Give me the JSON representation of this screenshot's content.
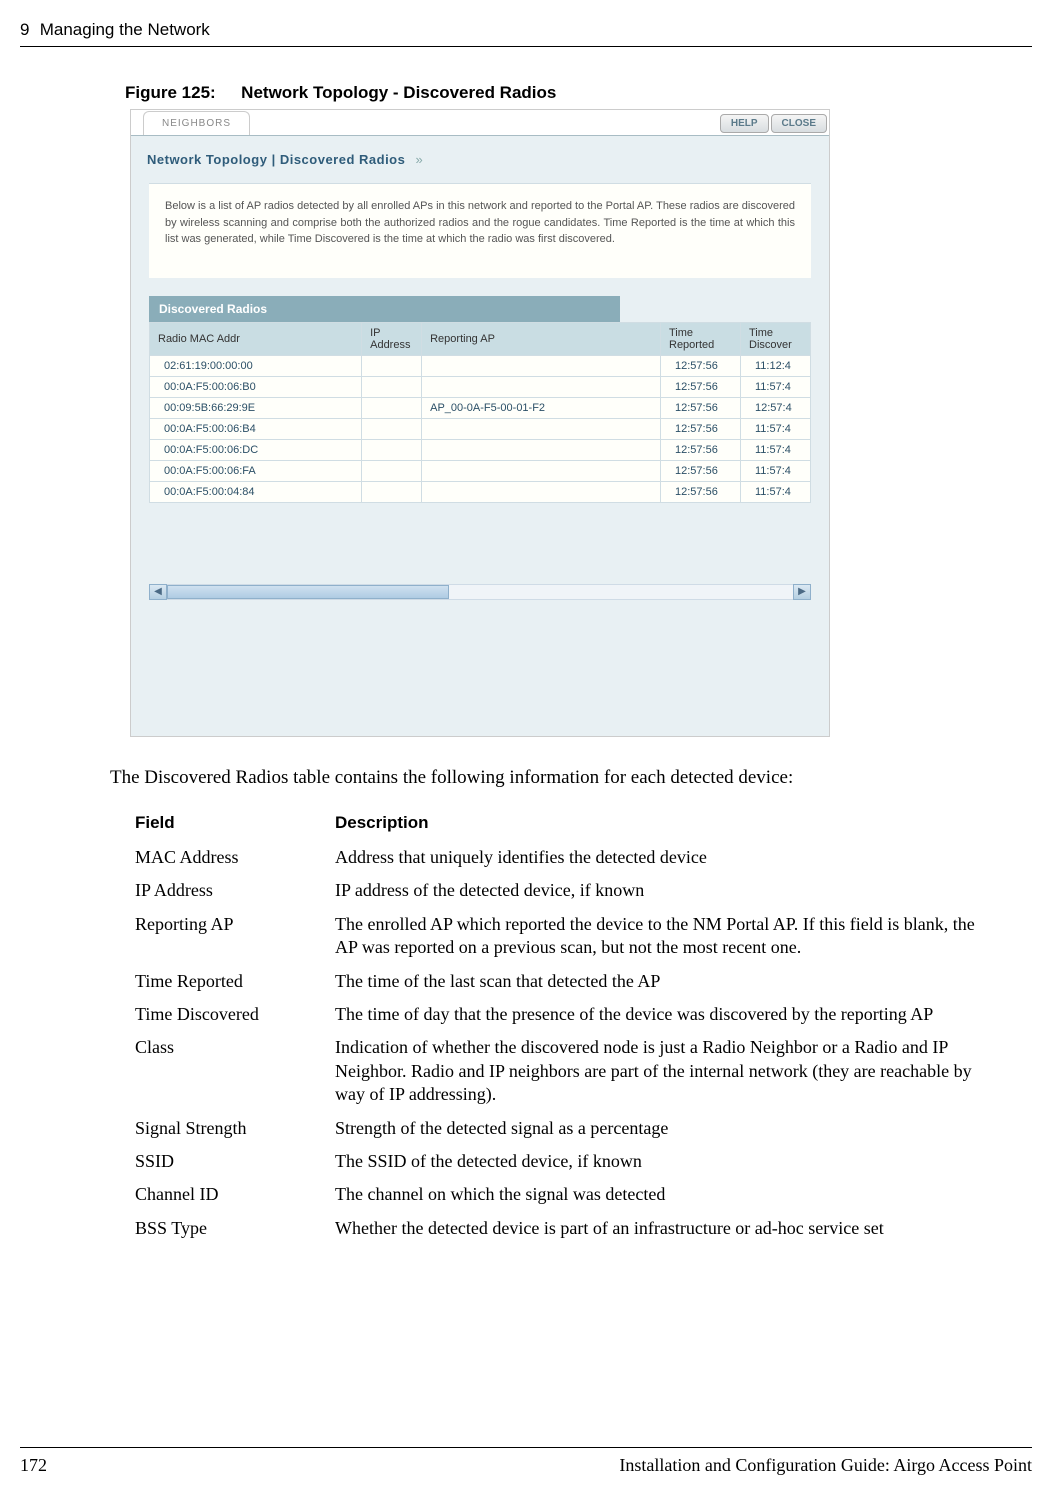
{
  "page": {
    "chapter_num": "9",
    "chapter_title": "Managing the Network",
    "page_number": "172",
    "guide_title": "Installation and Configuration Guide: Airgo Access Point"
  },
  "figure": {
    "label": "Figure 125:",
    "title": "Network Topology - Discovered Radios"
  },
  "screenshot": {
    "tab": "NEIGHBORS",
    "help": "HELP",
    "close": "CLOSE",
    "breadcrumb_main": "Network Topology",
    "breadcrumb_sub": "Discovered Radios",
    "breadcrumb_arrows": "»",
    "intro": "Below is a list of AP radios detected by all enrolled APs in this network and reported to the Portal AP. These radios are discovered by wireless scanning and comprise both the authorized radios and the rogue candidates. Time Reported is the time at which this list was generated, while Time Discovered is the time at which the radio was first discovered.",
    "section_title": "Discovered Radios",
    "columns": {
      "mac": "Radio MAC Addr",
      "ip": "IP Address",
      "reporting": "Reporting AP",
      "time_reported": "Time Reported",
      "time_discovered": "Time Discover"
    },
    "rows": [
      {
        "mac": "02:61:19:00:00:00",
        "ip": "",
        "reporting": "",
        "reported": "12:57:56",
        "discovered": "11:12:4"
      },
      {
        "mac": "00:0A:F5:00:06:B0",
        "ip": "",
        "reporting": "",
        "reported": "12:57:56",
        "discovered": "11:57:4"
      },
      {
        "mac": "00:09:5B:66:29:9E",
        "ip": "",
        "reporting": "AP_00-0A-F5-00-01-F2",
        "reported": "12:57:56",
        "discovered": "12:57:4"
      },
      {
        "mac": "00:0A:F5:00:06:B4",
        "ip": "",
        "reporting": "",
        "reported": "12:57:56",
        "discovered": "11:57:4"
      },
      {
        "mac": "00:0A:F5:00:06:DC",
        "ip": "",
        "reporting": "",
        "reported": "12:57:56",
        "discovered": "11:57:4"
      },
      {
        "mac": "00:0A:F5:00:06:FA",
        "ip": "",
        "reporting": "",
        "reported": "12:57:56",
        "discovered": "11:57:4"
      },
      {
        "mac": "00:0A:F5:00:04:84",
        "ip": "",
        "reporting": "",
        "reported": "12:57:56",
        "discovered": "11:57:4"
      }
    ]
  },
  "intro_sentence": "The Discovered Radios table contains the following information for each detected device:",
  "fields_header": {
    "field": "Field",
    "description": "Description"
  },
  "fields": [
    {
      "name": "MAC Address",
      "desc": "Address that uniquely identifies the detected device"
    },
    {
      "name": "IP Address",
      "desc": "IP address of the detected device, if known"
    },
    {
      "name": "Reporting AP",
      "desc": "The enrolled AP which reported the device to the NM Portal AP. If this field is blank, the AP was reported on a previous scan, but not the most recent one."
    },
    {
      "name": "Time Reported",
      "desc": "The time of the last scan that detected the AP"
    },
    {
      "name": "Time Discovered",
      "desc": "The time of day that the presence of the device was discovered by the reporting AP"
    },
    {
      "name": "Class",
      "desc": "Indication of whether the discovered node is just a Radio Neighbor or a Radio and IP Neighbor. Radio and IP neighbors are part of the internal network (they are reachable by way of IP addressing)."
    },
    {
      "name": "Signal Strength",
      "desc": "Strength of the detected signal as a percentage"
    },
    {
      "name": "SSID",
      "desc": "The SSID of the detected device, if known"
    },
    {
      "name": "Channel ID",
      "desc": "The channel on which the signal was detected"
    },
    {
      "name": "BSS Type",
      "desc": "Whether the detected device is part of an infrastructure or ad-hoc service set"
    }
  ]
}
